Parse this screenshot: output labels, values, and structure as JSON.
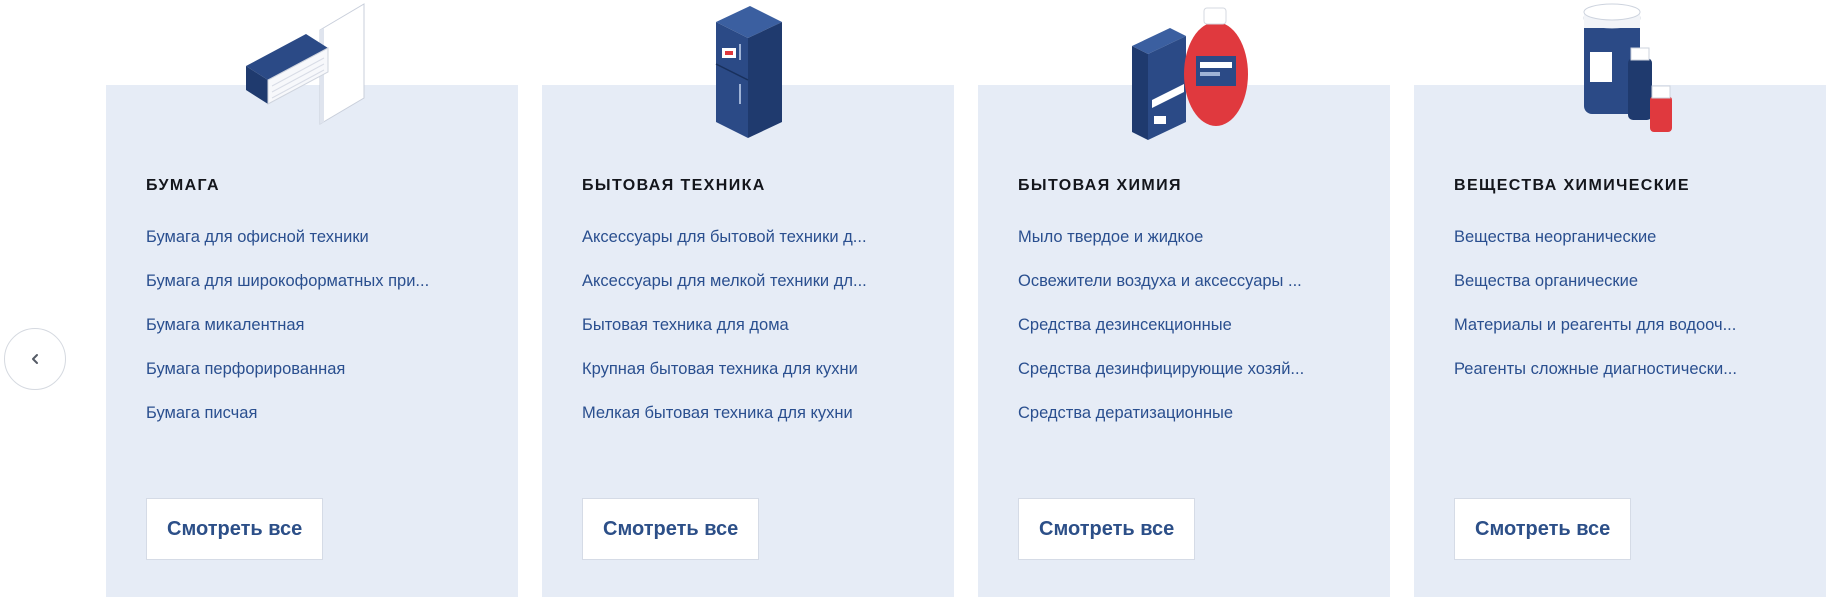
{
  "carousel": {
    "prev_icon": "chevron-left-icon",
    "cards": [
      {
        "title": "БУМАГА",
        "illustration": "paper-box-icon",
        "links": [
          "Бумага для офисной техники",
          "Бумага для широкоформатных при...",
          "Бумага микалентная",
          "Бумага перфорированная",
          "Бумага писчая"
        ],
        "view_all": "Смотреть все"
      },
      {
        "title": "БЫТОВАЯ ТЕХНИКА",
        "illustration": "refrigerator-icon",
        "links": [
          "Аксессуары для бытовой техники д...",
          "Аксессуары для мелкой техники дл...",
          "Бытовая техника для дома",
          "Крупная бытовая техника для кухни",
          "Мелкая бытовая техника для кухни"
        ],
        "view_all": "Смотреть все"
      },
      {
        "title": "БЫТОВАЯ ХИМИЯ",
        "illustration": "detergent-icon",
        "links": [
          "Мыло твердое и жидкое",
          "Освежители воздуха и аксессуары ...",
          "Средства дезинсекционные",
          "Средства дезинфицирующие хозяй...",
          "Средства дератизационные"
        ],
        "view_all": "Смотреть все"
      },
      {
        "title": "ВЕЩЕСТВА ХИМИЧЕСКИЕ",
        "illustration": "chemical-jars-icon",
        "links": [
          "Вещества неорганические",
          "Вещества органические",
          "Материалы и реагенты для водооч...",
          "Реагенты сложные диагностически..."
        ],
        "view_all": "Смотреть все"
      }
    ]
  },
  "colors": {
    "card_bg": "#e6ecf6",
    "link": "#2a4f8f",
    "title": "#14161c",
    "illustration_blue": "#2f4f8f",
    "illustration_red": "#e0393e"
  }
}
